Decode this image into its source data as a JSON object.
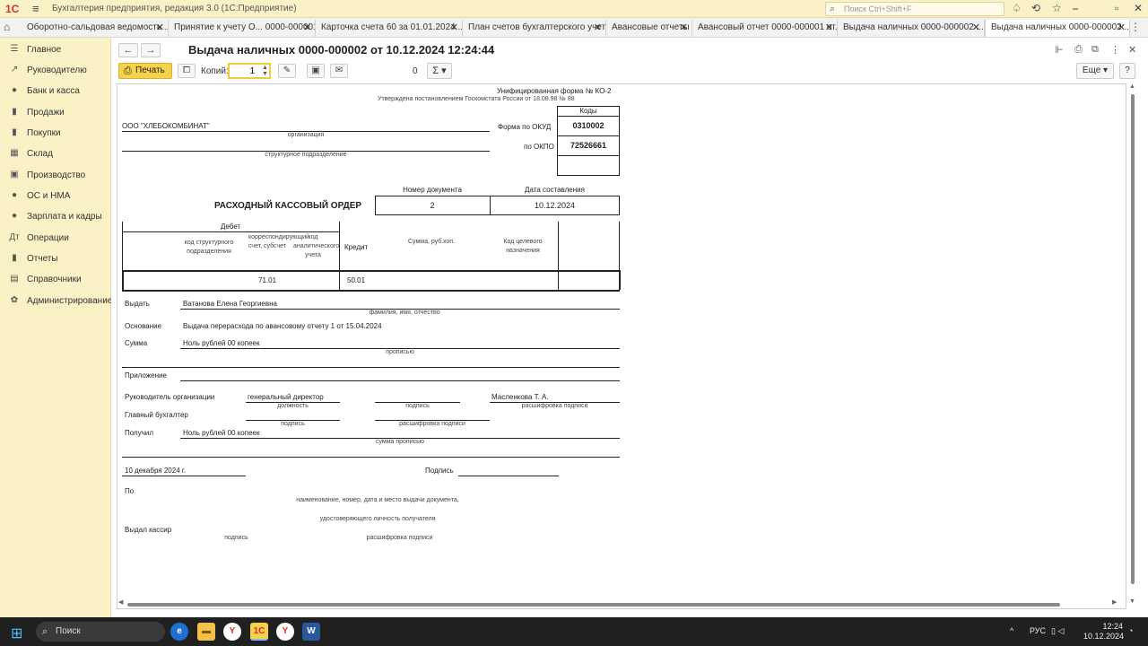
{
  "window": {
    "logo": "1С",
    "app_title": "Бухгалтерия предприятия, редакция 3.0 (1С:Предприятие)",
    "search_placeholder": "Поиск Ctrl+Shift+F"
  },
  "tabs": [
    {
      "label": "Оборотно-сальдовая ведомость ..."
    },
    {
      "label": "Принятие к учету О... 0000-000001"
    },
    {
      "label": "Карточка счета 60 за 01.01.2024 ..."
    },
    {
      "label": "План счетов бухгалтерского учета"
    },
    {
      "label": "Авансовые отчеты"
    },
    {
      "label": "Авансовый отчет 0000-000001 от..."
    },
    {
      "label": "Выдача наличных 0000-000002 ..."
    },
    {
      "label": "Выдача наличных 0000-000002 ..."
    }
  ],
  "sidebar": {
    "items": [
      {
        "label": "Главное",
        "icon": "☰"
      },
      {
        "label": "Руководителю",
        "icon": "↗"
      },
      {
        "label": "Банк и касса",
        "icon": "●"
      },
      {
        "label": "Продажи",
        "icon": "▮"
      },
      {
        "label": "Покупки",
        "icon": "▮"
      },
      {
        "label": "Склад",
        "icon": "▦"
      },
      {
        "label": "Производство",
        "icon": "▣"
      },
      {
        "label": "ОС и НМА",
        "icon": "●"
      },
      {
        "label": "Зарплата и кадры",
        "icon": "●"
      },
      {
        "label": "Операции",
        "icon": "Дт"
      },
      {
        "label": "Отчеты",
        "icon": "▮"
      },
      {
        "label": "Справочники",
        "icon": "▤"
      },
      {
        "label": "Администрирование",
        "icon": "✿"
      }
    ]
  },
  "toolbar": {
    "document_title": "Выдача наличных 0000-000002 от 10.12.2024 12:24:44",
    "print_label": "Печать",
    "copies_label": "Копий:",
    "copies_value": "1",
    "sum_value": "0",
    "sum_symbol": "Σ",
    "more_label": "Еще",
    "help_label": "?"
  },
  "form": {
    "unified_form": "Унифицированная форма № КО-2",
    "approved_by": "Утверждена постановлением Госкомстата России от 18.08.98 № 88",
    "codes_header": "Коды",
    "okud_label": "Форма по ОКУД",
    "okud_code": "0310002",
    "okpo_label": "по ОКПО",
    "okpo_code": "72526661",
    "organization": "ООО \"ХЛЕБОКОМБИНАТ\"",
    "organization_caption": "организация",
    "division_caption": "структурное подразделение",
    "doc_number_header": "Номер документа",
    "doc_date_header": "Дата составления",
    "doc_title": "РАСХОДНЫЙ КАССОВЫЙ ОРДЕР",
    "doc_number": "2",
    "doc_date": "10.12.2024",
    "debit_header": "Дебет",
    "col_division_code": "код структурного подразделения",
    "col_corr_account": "корреспондирующий счет, субсчет",
    "col_analytics_code": "код аналитического учета",
    "col_credit": "Кредит",
    "col_amount": "Сумма, руб.коп.",
    "col_purpose_code": "Код целевого назначения",
    "corr_account_value": "71.01",
    "credit_value": "50.01",
    "issue_label": "Выдать",
    "issue_value": "Ватанова Елена Георгиевна",
    "issue_caption": "фамилия, имя, отчество",
    "basis_label": "Основание",
    "basis_value": "Выдача перерасхода по авансовому отчету 1 от 15.04.2024",
    "amount_label": "Сумма",
    "amount_value": "Ноль рублей 00 копеек",
    "amount_caption": "прописью",
    "attachment_label": "Приложение",
    "head_label": "Руководитель организации",
    "head_position": "генеральный директор",
    "head_name": "Масленкова Т. А.",
    "position_caption": "должность",
    "signature_caption": "подпись",
    "decoding_caption": "расшифровка подписи",
    "chief_accountant_label": "Главный бухгалтер",
    "received_label": "Получил",
    "received_value": "Ноль рублей 00 копеек",
    "received_caption": "сумма прописью",
    "date_value": "10 декабря 2024 г.",
    "signature_label": "Подпись",
    "by_label": "По",
    "id_doc_caption": "наименование, номер, дата и место выдачи документа,",
    "id_doc_caption2": "удостоверяющего личность получателя",
    "cashier_label": "Выдал кассир"
  },
  "taskbar": {
    "search_label": "Поиск",
    "lang": "РУС",
    "time": "12:24",
    "date": "10.12.2024"
  }
}
